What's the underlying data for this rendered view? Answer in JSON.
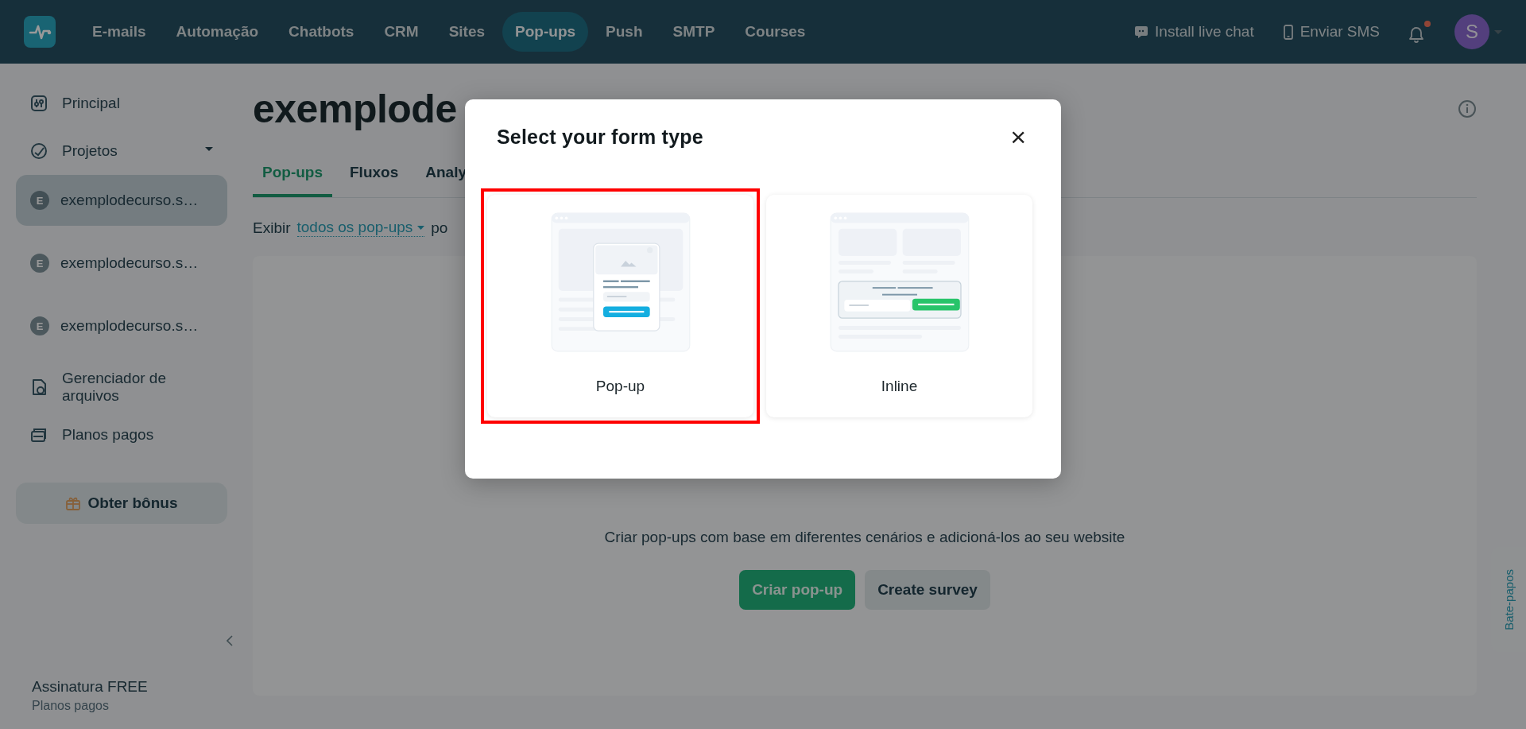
{
  "nav": {
    "items": [
      {
        "label": "E-mails",
        "selected": false
      },
      {
        "label": "Automação",
        "selected": false
      },
      {
        "label": "Chatbots",
        "selected": false
      },
      {
        "label": "CRM",
        "selected": false
      },
      {
        "label": "Sites",
        "selected": false
      },
      {
        "label": "Pop-ups",
        "selected": true
      },
      {
        "label": "Push",
        "selected": false
      },
      {
        "label": "SMTP",
        "selected": false
      },
      {
        "label": "Courses",
        "selected": false
      }
    ],
    "actions": [
      {
        "label": "Install live chat",
        "kind": "chat"
      },
      {
        "label": "Enviar SMS",
        "kind": "phone"
      }
    ],
    "notifications": {
      "unread": true
    },
    "avatar": {
      "initial": "S"
    }
  },
  "sidebar": {
    "items": [
      {
        "label": "Principal",
        "kind": "main"
      },
      {
        "label": "Projetos",
        "kind": "projects",
        "expanded": true,
        "children": [
          {
            "label": "exemplodecurso.s…",
            "initial": "E",
            "selected": true
          },
          {
            "label": "exemplodecurso.s…",
            "initial": "E",
            "selected": false
          },
          {
            "label": "exemplodecurso.s…",
            "initial": "E",
            "selected": false
          }
        ]
      },
      {
        "label": "Gerenciador de arquivos",
        "kind": "files"
      },
      {
        "label": "Planos pagos",
        "kind": "plans"
      }
    ],
    "bonus_button": "Obter bônus",
    "subscription": {
      "plan": "Assinatura FREE",
      "link": "Planos pagos"
    }
  },
  "main": {
    "title": "exemplode",
    "tabs": [
      {
        "label": "Pop-ups",
        "selected": true
      },
      {
        "label": "Fluxos",
        "selected": false
      },
      {
        "label": "Analy",
        "selected": false
      }
    ],
    "filter": {
      "prefix": "Exibir",
      "value": "todos os pop-ups",
      "suffix": "po"
    },
    "empty_state": {
      "text": "Criar pop-ups com base em diferentes cenários e adicioná-los ao seu website",
      "buttons": [
        {
          "label": "Criar pop-up",
          "kind": "primary"
        },
        {
          "label": "Create survey",
          "kind": "secondary"
        }
      ]
    }
  },
  "chat_tab": "Bate-papos",
  "modal": {
    "title": "Select your form type",
    "close": "×",
    "options": [
      {
        "label": "Pop-up",
        "kind": "popup",
        "highlighted": true
      },
      {
        "label": "Inline",
        "kind": "inline",
        "highlighted": false
      }
    ]
  }
}
